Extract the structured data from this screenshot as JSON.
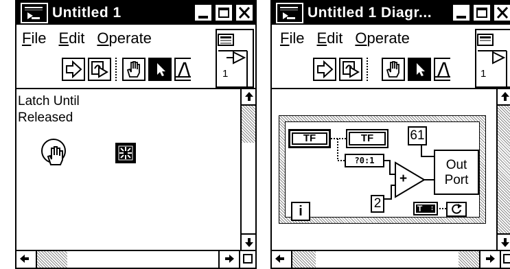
{
  "front_panel": {
    "title": "Untitled 1",
    "menus": [
      "File",
      "Edit",
      "Operate"
    ],
    "menu_underline": [
      "F",
      "E",
      "O"
    ],
    "connector_number": "1",
    "control_label_line1": "Latch Until",
    "control_label_line2": "Released"
  },
  "diagram": {
    "title": "Untitled 1 Diagr...",
    "menus": [
      "File",
      "Edit",
      "Operate"
    ],
    "connector_number": "1",
    "tf_control": "TF",
    "tf_indicator": "TF",
    "to_i16_label": "?0:1",
    "constant_61": "61",
    "constant_2": "2",
    "out_port_line1": "Out",
    "out_port_line2": "Port",
    "iteration_terminal": "i",
    "plus_sign": "+",
    "stop_terminal": "T"
  }
}
